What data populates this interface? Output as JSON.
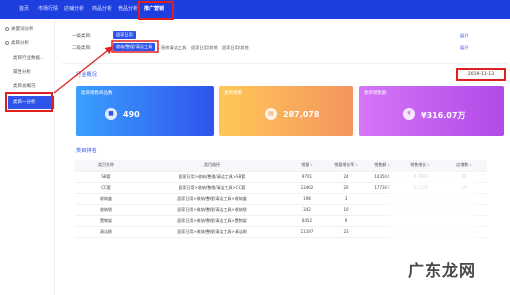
{
  "topnav": {
    "items": [
      {
        "label": "首页"
      },
      {
        "label": "市场行情"
      },
      {
        "label": "店铺分析"
      },
      {
        "label": "商品分析"
      },
      {
        "label": "竞品分析"
      },
      {
        "label": "推广营销"
      }
    ]
  },
  "sidebar": {
    "items": [
      {
        "label": "关键词分析"
      },
      {
        "label": "类目分析"
      },
      {
        "label": "类目行业数据..."
      },
      {
        "label": "属性分析"
      },
      {
        "label": "类目总概况"
      }
    ],
    "active": "类目一分析"
  },
  "filters": {
    "level1_label": "一级类目:",
    "level1_value": "居家日用",
    "level1_more": "展开",
    "level2_label": "二级类目:",
    "level2_options": [
      {
        "label": "收纳/整理/清洁工具"
      },
      {
        "label": "厨房清洁工具"
      },
      {
        "label": "居家日用/其他"
      },
      {
        "label": "居家日用/其他"
      }
    ],
    "level2_more": "展开"
  },
  "overview": {
    "title": "行业概况",
    "date": "2019-11-13",
    "cards": [
      {
        "title": "类目销售商品数",
        "value": "490",
        "icon": "box-icon",
        "color": "#3b6bfb"
      },
      {
        "title": "类目销量",
        "value": "287,078",
        "icon": "cart-icon",
        "color": "#f5a24a"
      },
      {
        "title": "类目销售额",
        "value": "¥316.07万",
        "icon": "coin-icon",
        "color": "#c25cf0"
      }
    ]
  },
  "ranking": {
    "title": "类目排名",
    "columns": [
      {
        "label": "类目名称",
        "sortable": false
      },
      {
        "label": "类目路径",
        "sortable": false
      },
      {
        "label": "销量",
        "sortable": true
      },
      {
        "label": "销量增长率",
        "sortable": true
      },
      {
        "label": "销售额",
        "sortable": true
      },
      {
        "label": "销售增长",
        "sortable": true
      },
      {
        "label": "店铺数",
        "sortable": true
      }
    ],
    "rows": [
      {
        "name": "SB套",
        "path": "居家日用>收纳/整理/清洁工具>SB套",
        "sales": "9701",
        "sales_growth": "24",
        "revenue": "143504",
        "revenue_growth": "-0.2893",
        "shops": "22"
      },
      {
        "name": "CC套",
        "path": "居家日用>收纳/整理/清洁工具>CC套",
        "sales": "13462",
        "sales_growth": "20",
        "revenue": "177367",
        "revenue_growth": "-0.1219",
        "shops": "19"
      },
      {
        "name": "收纳盒",
        "path": "居家日用>收纳/整理/清洁工具>收纳盒",
        "sales": "198",
        "sales_growth": "3",
        "revenue": "",
        "revenue_growth": "",
        "shops": ""
      },
      {
        "name": "收纳袋",
        "path": "居家日用>收纳/整理/清洁工具>收纳袋",
        "sales": "342",
        "sales_growth": "10",
        "revenue": "",
        "revenue_growth": "",
        "shops": ""
      },
      {
        "name": "置物架",
        "path": "居家日用>收纳/整理/清洁工具>置物架",
        "sales": "8452",
        "sales_growth": "9",
        "revenue": "",
        "revenue_growth": "",
        "shops": ""
      },
      {
        "name": "清洁刷",
        "path": "居家日用>收纳/整理/清洁工具>清洁刷",
        "sales": "11197",
        "sales_growth": "23",
        "revenue": "",
        "revenue_growth": "",
        "shops": ""
      }
    ]
  },
  "watermark": "广东龙网"
}
